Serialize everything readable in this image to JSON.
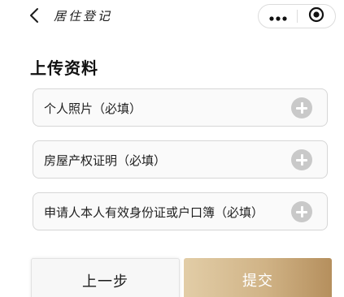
{
  "header": {
    "title": "居住登记",
    "back_icon": "chevron-left-icon",
    "more_icon": "more-dots-icon",
    "close_icon": "target-close-icon"
  },
  "section": {
    "title": "上传资料"
  },
  "uploads": [
    {
      "label": "个人照片（必填）",
      "icon": "add-circle-icon"
    },
    {
      "label": "房屋产权证明（必填）",
      "icon": "add-circle-icon"
    },
    {
      "label": "申请人本人有效身份证或户口簿（必填）",
      "icon": "add-circle-icon"
    }
  ],
  "actions": {
    "prev_label": "上一步",
    "submit_label": "提交"
  },
  "colors": {
    "submit_gradient_start": "#e2cda7",
    "submit_gradient_end": "#b58f5d",
    "add_icon": "#c9c9c9",
    "row_border": "#d6d6d6"
  }
}
